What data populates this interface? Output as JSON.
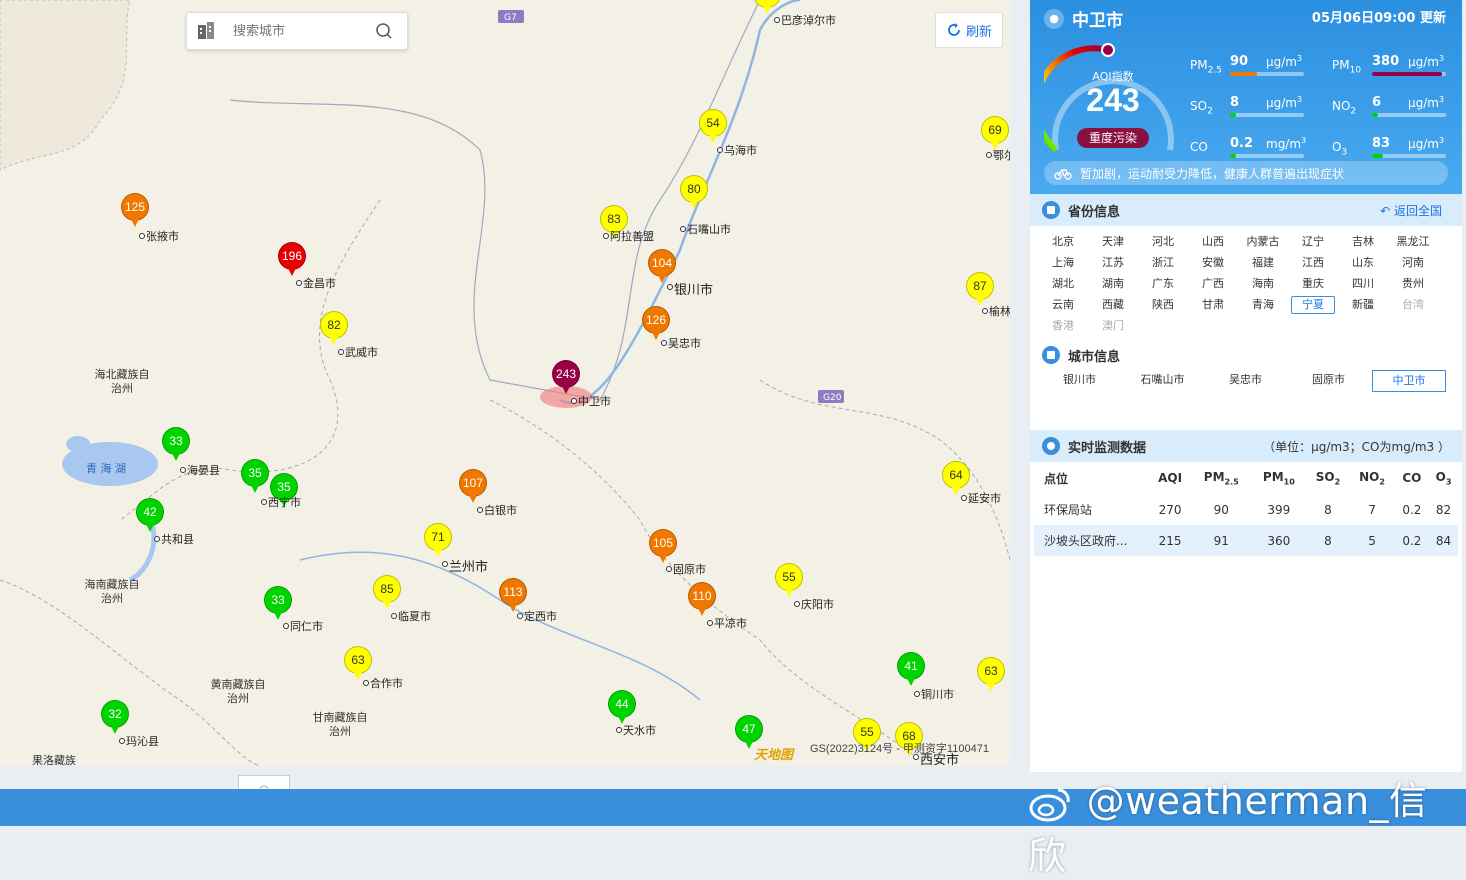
{
  "search": {
    "placeholder": "搜索城市"
  },
  "toolbar": {
    "refresh_label": "刷新"
  },
  "map": {
    "road_labels": [
      "G7",
      "G20"
    ],
    "copyright": "GS(2022)3124号 - 甲测资字1100471",
    "logo": "天地图",
    "stations": [
      {
        "aqi": "125",
        "color": "#f07800",
        "text_color": "#fff",
        "name": "张掖市"
      },
      {
        "aqi": "196",
        "color": "#e60000",
        "text_color": "#fff",
        "name": "金昌市"
      },
      {
        "aqi": "82",
        "color": "#ffff00",
        "text_color": "#333",
        "name": "武威市"
      },
      {
        "aqi": "33",
        "color": "#00d400",
        "text_color": "#fff",
        "name": "海晏县"
      },
      {
        "aqi": "35",
        "color": "#00d400",
        "text_color": "#fff",
        "name": ""
      },
      {
        "aqi": "35",
        "color": "#00d400",
        "text_color": "#fff",
        "name": "西宁市"
      },
      {
        "aqi": "42",
        "color": "#00d400",
        "text_color": "#fff",
        "name": "共和县"
      },
      {
        "aqi": "33",
        "color": "#00d400",
        "text_color": "#fff",
        "name": "同仁市"
      },
      {
        "aqi": "32",
        "color": "#00d400",
        "text_color": "#fff",
        "name": "玛沁县"
      },
      {
        "aqi": "85",
        "color": "#ffff00",
        "text_color": "#333",
        "name": "临夏市"
      },
      {
        "aqi": "63",
        "color": "#ffff00",
        "text_color": "#333",
        "name": "合作市"
      },
      {
        "aqi": "71",
        "color": "#ffff00",
        "text_color": "#333",
        "name": "兰州市"
      },
      {
        "aqi": "107",
        "color": "#f07800",
        "text_color": "#fff",
        "name": "白银市"
      },
      {
        "aqi": "113",
        "color": "#f07800",
        "text_color": "#fff",
        "name": "定西市"
      },
      {
        "aqi": "44",
        "color": "#00d400",
        "text_color": "#fff",
        "name": "天水市"
      },
      {
        "aqi": "243",
        "color": "#990045",
        "text_color": "#fff",
        "name": "中卫市"
      },
      {
        "aqi": "83",
        "color": "#ffff00",
        "text_color": "#333",
        "name": "阿拉善盟"
      },
      {
        "aqi": "54",
        "color": "#ffff00",
        "text_color": "#333",
        "name": "乌海市"
      },
      {
        "aqi": "80",
        "color": "#ffff00",
        "text_color": "#333",
        "name": "石嘴山市"
      },
      {
        "aqi": "104",
        "color": "#f07800",
        "text_color": "#fff",
        "name": "银川市"
      },
      {
        "aqi": "126",
        "color": "#f07800",
        "text_color": "#fff",
        "name": "吴忠市"
      },
      {
        "aqi": "105",
        "color": "#f07800",
        "text_color": "#fff",
        "name": "固原市"
      },
      {
        "aqi": "110",
        "color": "#f07800",
        "text_color": "#fff",
        "name": "平凉市"
      },
      {
        "aqi": "55",
        "color": "#ffff00",
        "text_color": "#333",
        "name": "庆阳市"
      },
      {
        "aqi": "47",
        "color": "#00d400",
        "text_color": "#fff",
        "name": ""
      },
      {
        "aqi": "55",
        "color": "#ffff00",
        "text_color": "#333",
        "name": ""
      },
      {
        "aqi": "68",
        "color": "#ffff00",
        "text_color": "#333",
        "name": "西安市"
      },
      {
        "aqi": "41",
        "color": "#00d400",
        "text_color": "#fff",
        "name": "铜川市"
      },
      {
        "aqi": "63",
        "color": "#ffff00",
        "text_color": "#333",
        "name": ""
      },
      {
        "aqi": "64",
        "color": "#ffff00",
        "text_color": "#333",
        "name": "延安市"
      },
      {
        "aqi": "87",
        "color": "#ffff00",
        "text_color": "#333",
        "name": "榆林"
      },
      {
        "aqi": "69",
        "color": "#ffff00",
        "text_color": "#333",
        "name": "鄂尔"
      },
      {
        "aqi": "",
        "color": "#ffff00",
        "text_color": "#333",
        "name": "巴彦淖尔市"
      }
    ],
    "regions": [
      "海北藏族自治州",
      "海南藏族自治州",
      "黄南藏族自治州",
      "甘南藏族自治州",
      "果洛藏族"
    ],
    "lake": "青 海 湖"
  },
  "panel": {
    "city": "中卫市",
    "update_time": "05月06日09:00 更新",
    "aqi_label": "AQI指数",
    "aqi_value": "243",
    "level": "重度污染",
    "pollutants": [
      {
        "name": "PM",
        "sub": "2.5",
        "value": "90",
        "unit": "μg/m",
        "sup": "3",
        "fill": 0.36,
        "color": "#f07800"
      },
      {
        "name": "PM",
        "sub": "10",
        "value": "380",
        "unit": "μg/m",
        "sup": "3",
        "fill": 0.95,
        "color": "#990045"
      },
      {
        "name": "SO",
        "sub": "2",
        "value": "8",
        "unit": "μg/m",
        "sup": "3",
        "fill": 0.0,
        "color": "#00d400"
      },
      {
        "name": "NO",
        "sub": "2",
        "value": "6",
        "unit": "μg/m",
        "sup": "3",
        "fill": 0.0,
        "color": "#00d400"
      },
      {
        "name": "CO",
        "sub": "",
        "value": "0.2",
        "unit": "mg/m",
        "sup": "3",
        "fill": 0.0,
        "color": "#00d400"
      },
      {
        "name": "O",
        "sub": "3",
        "value": "83",
        "unit": "μg/m",
        "sup": "3",
        "fill": 0.15,
        "color": "#00d400"
      }
    ],
    "advice": "暂加剧，运动耐受力降低，健康人群普遍出现症状",
    "province_section": {
      "title": "省份信息",
      "back_label": "返回全国"
    },
    "provinces": [
      "北京",
      "天津",
      "河北",
      "山西",
      "内蒙古",
      "辽宁",
      "吉林",
      "黑龙江",
      "上海",
      "江苏",
      "浙江",
      "安徽",
      "福建",
      "江西",
      "山东",
      "河南",
      "湖北",
      "湖南",
      "广东",
      "广西",
      "海南",
      "重庆",
      "四川",
      "贵州",
      "云南",
      "西藏",
      "陕西",
      "甘肃",
      "青海",
      "宁夏",
      "新疆",
      "台湾",
      "香港",
      "澳门"
    ],
    "selected_province": "宁夏",
    "city_section": {
      "title": "城市信息"
    },
    "cities": [
      "银川市",
      "石嘴山市",
      "吴忠市",
      "固原市",
      "中卫市"
    ],
    "selected_city": "中卫市",
    "realtime": {
      "title": "实时监测数据",
      "unit_note": "（单位：μg/m3；CO为mg/m3 ）",
      "headers": [
        "点位",
        "AQI",
        "PM2.5",
        "PM10",
        "SO2",
        "NO2",
        "CO",
        "O3"
      ],
      "rows": [
        [
          "环保局站",
          "270",
          "90",
          "399",
          "8",
          "7",
          "0.2",
          "82"
        ],
        [
          "沙坡头区政府...",
          "215",
          "91",
          "360",
          "8",
          "5",
          "0.2",
          "84"
        ]
      ]
    }
  },
  "watermark": "@weatherman_信欣"
}
